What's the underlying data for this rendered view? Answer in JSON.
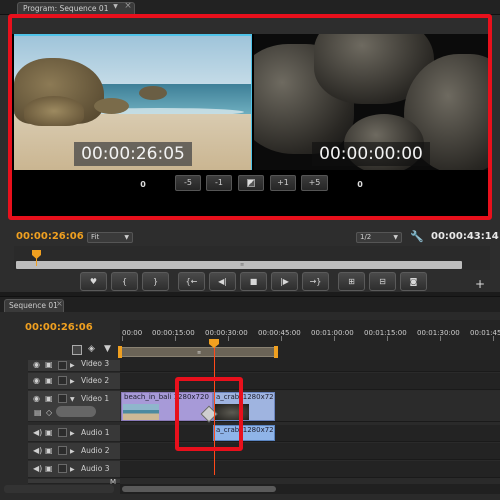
{
  "monitor": {
    "tab_label": "Program: Sequence 01",
    "tab_menu_icon": "dropdown-triangle",
    "tab_close_icon": "x",
    "left_timecode": "00:00:26:05",
    "right_timecode": "00:00:00:00",
    "trim": {
      "left_offset": "0",
      "right_offset": "0",
      "buttons": [
        "-5",
        "-1",
        "",
        "+1",
        "+5"
      ]
    },
    "current_time": "00:00:26:06",
    "zoom_select": "Fit",
    "resolution_select": "1/2",
    "duration": "00:00:43:14",
    "transport_buttons": [
      {
        "name": "add-marker-button",
        "glyph": "♥"
      },
      {
        "name": "mark-in-button",
        "glyph": "{"
      },
      {
        "name": "mark-out-button",
        "glyph": "}"
      },
      {
        "name": "go-to-in-button",
        "glyph": "{←"
      },
      {
        "name": "step-back-button",
        "glyph": "◀|"
      },
      {
        "name": "stop-button",
        "glyph": "■"
      },
      {
        "name": "step-forward-button",
        "glyph": "|▶"
      },
      {
        "name": "go-to-out-button",
        "glyph": "→}"
      },
      {
        "name": "lift-button",
        "glyph": "⊞"
      },
      {
        "name": "extract-button",
        "glyph": "⊟"
      },
      {
        "name": "export-frame-button",
        "glyph": "◙"
      }
    ],
    "add_button_glyph": "+"
  },
  "timeline": {
    "tab_label": "Sequence 01",
    "tab_close_icon": "x",
    "current_time": "00:00:26:06",
    "ruler_labels": [
      "00:00",
      "00:00:15:00",
      "00:00:30:00",
      "00:00:45:00",
      "00:01:00:00",
      "00:01:15:00",
      "00:01:30:00",
      "00:01:45:00"
    ],
    "tracks": {
      "video3": "Video 3",
      "video2": "Video 2",
      "video1": "Video 1",
      "audio1": "Audio 1",
      "audio2": "Audio 2",
      "audio3": "Audio 3"
    },
    "clips": {
      "beach_label": "beach_in_bali",
      "beach_res": "1280x720",
      "crab_video_label": "a_crab_1280x72",
      "crab_audio_label": "a_crab_1280x72"
    }
  },
  "colors": {
    "highlight_red": "#e8101c",
    "timecode_orange": "#f0a020",
    "video_clip": "#a79ad8",
    "audio_clip": "#8fb4e8",
    "selection_blue": "#4fc3e8"
  }
}
